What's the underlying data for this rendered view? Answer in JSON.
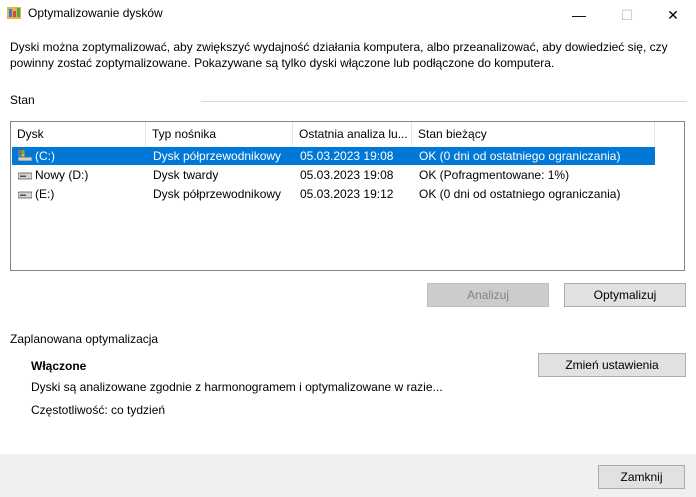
{
  "window": {
    "title": "Optymalizowanie dysków",
    "controls": {
      "minimize": "—",
      "maximize": "☐",
      "close": "✕"
    }
  },
  "description": "Dyski można zoptymalizować, aby zwiększyć wydajność działania komputera, albo przeanalizować, aby dowiedzieć się, czy powinny zostać zoptymalizowane. Pokazywane są tylko dyski włączone lub podłączone do komputera.",
  "status": {
    "label": "Stan",
    "columns": [
      "Dysk",
      "Typ nośnika",
      "Ostatnia analiza lu...",
      "Stan bieżący"
    ],
    "rows": [
      {
        "drive": "(C:)",
        "media": "Dysk półprzewodnikowy",
        "last": "05.03.2023 19:08",
        "state": "OK (0 dni od ostatniego ograniczania)",
        "icon": "system-drive-icon",
        "selected": true
      },
      {
        "drive": "Nowy (D:)",
        "media": "Dysk twardy",
        "last": "05.03.2023 19:08",
        "state": "OK (Pofragmentowane: 1%)",
        "icon": "drive-icon",
        "selected": false
      },
      {
        "drive": "(E:)",
        "media": "Dysk półprzewodnikowy",
        "last": "05.03.2023 19:12",
        "state": "OK (0 dni od ostatniego ograniczania)",
        "icon": "drive-icon",
        "selected": false
      }
    ]
  },
  "buttons": {
    "analyze": "Analizuj",
    "optimize": "Optymalizuj",
    "change_settings": "Zmień ustawienia",
    "close": "Zamknij"
  },
  "schedule": {
    "label": "Zaplanowana optymalizacja",
    "status": "Włączone",
    "description": "Dyski są analizowane zgodnie z harmonogramem i optymalizowane w razie...",
    "frequency": "Częstotliwość: co tydzień"
  },
  "colors": {
    "selection": "#0078d7",
    "footer": "#f0f0f0"
  }
}
